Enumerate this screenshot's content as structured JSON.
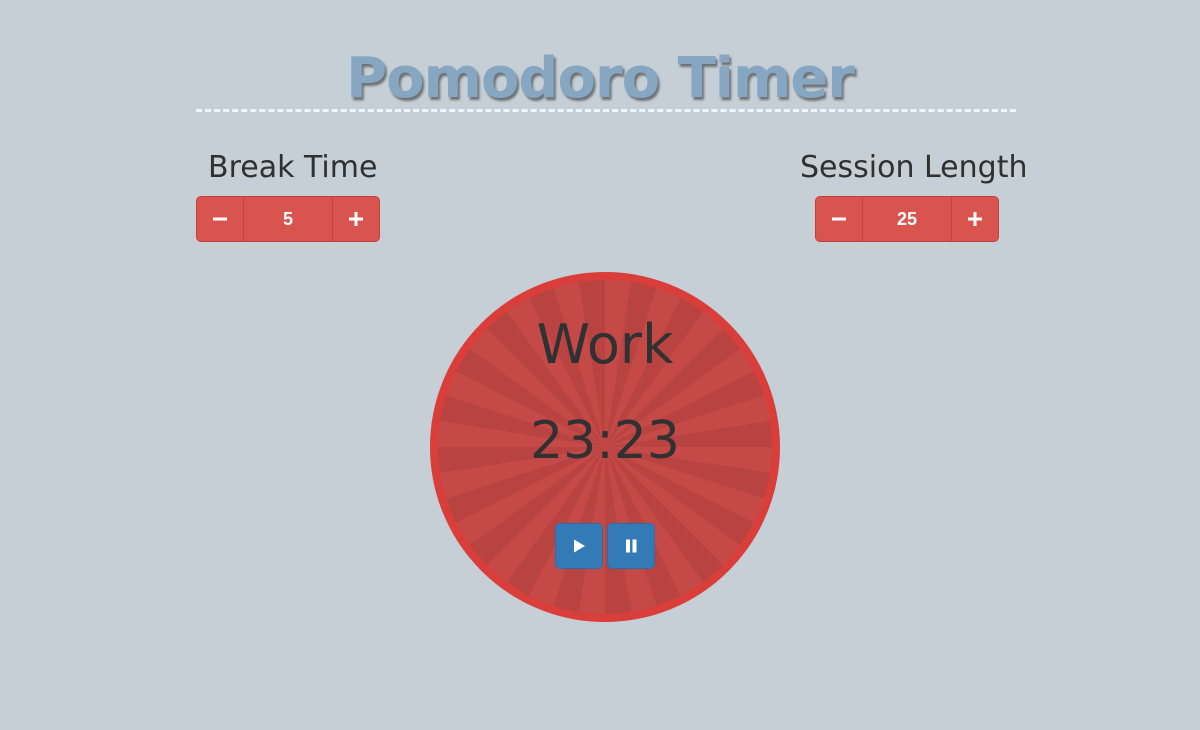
{
  "header": {
    "title": "Pomodoro Timer"
  },
  "break_setting": {
    "label": "Break Time",
    "value": "5",
    "decrement_icon": "minus-icon",
    "increment_icon": "plus-icon"
  },
  "session_setting": {
    "label": "Session Length",
    "value": "25",
    "decrement_icon": "minus-icon",
    "increment_icon": "plus-icon"
  },
  "timer": {
    "mode": "Work",
    "time": "23:23",
    "controls": [
      {
        "name": "play-button",
        "icon": "play-icon"
      },
      {
        "name": "pause-button",
        "icon": "pause-icon"
      }
    ]
  },
  "colors": {
    "background": "#c6cfd5",
    "title": "#86a6c1",
    "accent_red": "#d9534f",
    "circle_border": "#d93e3a",
    "control_blue": "#337ab7",
    "text_dark": "#2f3133"
  }
}
